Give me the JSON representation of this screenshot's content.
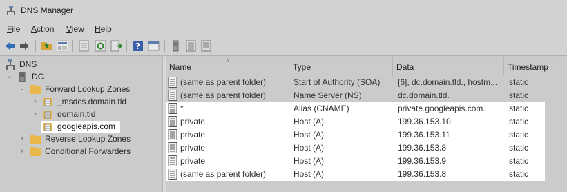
{
  "window": {
    "title": "DNS Manager"
  },
  "menu": [
    {
      "label": "File",
      "accel": "F",
      "rest": "ile"
    },
    {
      "label": "Action",
      "accel": "A",
      "rest": "ction"
    },
    {
      "label": "View",
      "accel": "V",
      "rest": "iew"
    },
    {
      "label": "Help",
      "accel": "H",
      "rest": "elp"
    }
  ],
  "toolbar": [
    "back-icon",
    "forward-icon",
    "up-folder-icon",
    "show-hide-tree-icon",
    "properties-icon",
    "refresh-icon",
    "export-list-icon",
    "help-icon",
    "console-icon",
    "server-icon",
    "zone-list-icon",
    "record-icon"
  ],
  "tree": {
    "root": "DNS",
    "server": "DC",
    "forward_zones": "Forward Lookup Zones",
    "zones": [
      "_msdcs.domain.tld",
      "domain.tld",
      "googleapis.com"
    ],
    "reverse_zones": "Reverse Lookup Zones",
    "conditional_forwarders": "Conditional Forwarders"
  },
  "columns": {
    "name": "Name",
    "type": "Type",
    "data": "Data",
    "timestamp": "Timestamp"
  },
  "records": [
    {
      "name": "(same as parent folder)",
      "type": "Start of Authority (SOA)",
      "data": "[6], dc.domain.tld., hostm...",
      "timestamp": "static",
      "highlight": false
    },
    {
      "name": "(same as parent folder)",
      "type": "Name Server (NS)",
      "data": "dc.domain.tld.",
      "timestamp": "static",
      "highlight": false
    },
    {
      "name": "*",
      "type": "Alias (CNAME)",
      "data": "private.googleapis.com.",
      "timestamp": "static",
      "highlight": true
    },
    {
      "name": "private",
      "type": "Host (A)",
      "data": "199.36.153.10",
      "timestamp": "static",
      "highlight": true
    },
    {
      "name": "private",
      "type": "Host (A)",
      "data": "199.36.153.11",
      "timestamp": "static",
      "highlight": true
    },
    {
      "name": "private",
      "type": "Host (A)",
      "data": "199.36.153.8",
      "timestamp": "static",
      "highlight": true
    },
    {
      "name": "private",
      "type": "Host (A)",
      "data": "199.36.153.9",
      "timestamp": "static",
      "highlight": true
    },
    {
      "name": "(same as parent folder)",
      "type": "Host (A)",
      "data": "199.36.153.8",
      "timestamp": "static",
      "highlight": true
    }
  ],
  "colors": {
    "chrome": "#d2d2d2",
    "pane": "#cbcbcb",
    "highlight": "#ffffff",
    "folder": "#e8b94a"
  }
}
